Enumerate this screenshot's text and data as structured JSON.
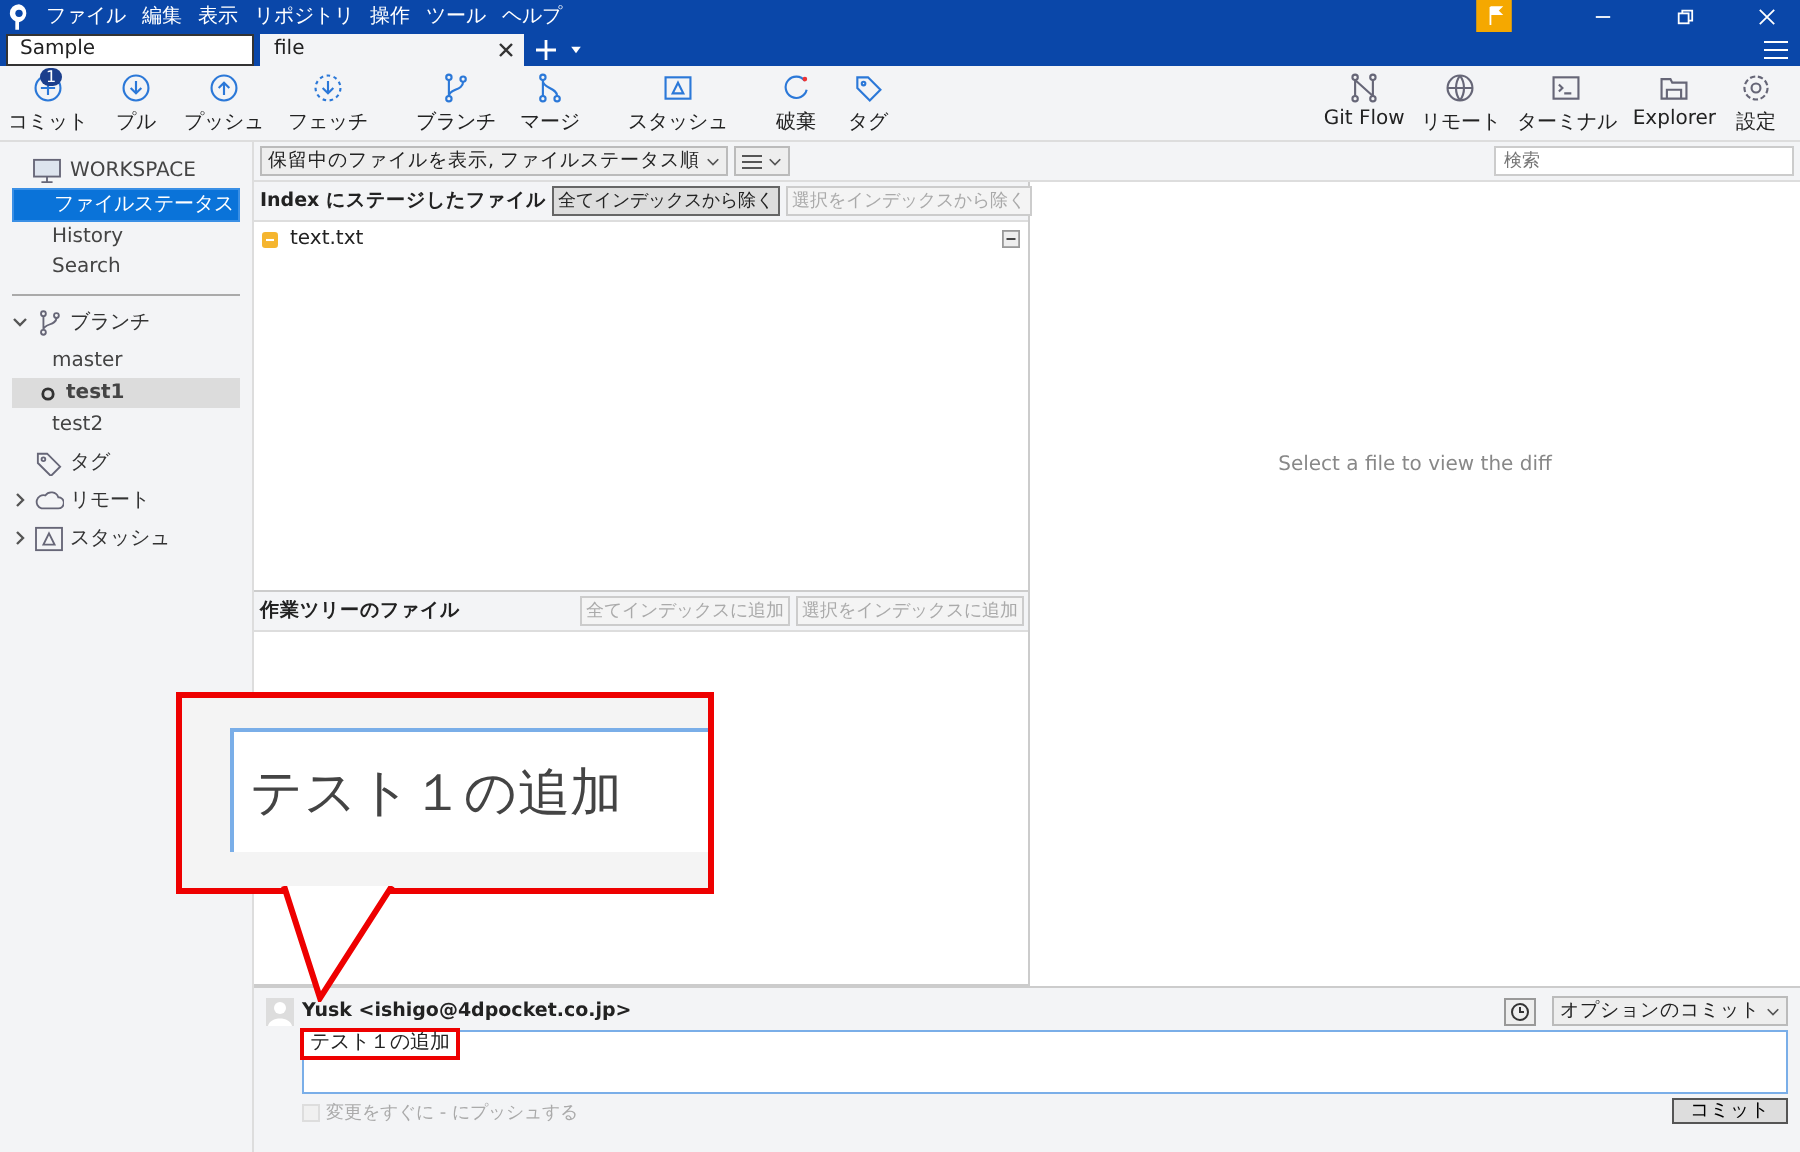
{
  "menu": [
    "ファイル",
    "編集",
    "表示",
    "リポジトリ",
    "操作",
    "ツール",
    "ヘルプ"
  ],
  "tabs": [
    {
      "label": "Sample",
      "selected": false
    },
    {
      "label": "file",
      "selected": true
    }
  ],
  "toolbar_left": [
    {
      "label": "コミット",
      "badge": "1"
    },
    {
      "label": "プル"
    },
    {
      "label": "プッシュ"
    },
    {
      "label": "フェッチ"
    },
    {
      "label": "ブランチ"
    },
    {
      "label": "マージ"
    },
    {
      "label": "スタッシュ"
    },
    {
      "label": "破棄"
    },
    {
      "label": "タグ"
    }
  ],
  "toolbar_right": [
    {
      "label": "Git Flow"
    },
    {
      "label": "リモート"
    },
    {
      "label": "ターミナル"
    },
    {
      "label": "Explorer"
    },
    {
      "label": "設定"
    }
  ],
  "sidebar": {
    "workspace": "WORKSPACE",
    "items": [
      {
        "label": "ファイルステータス",
        "selected": true
      },
      {
        "label": "History",
        "selected": false
      },
      {
        "label": "Search",
        "selected": false
      }
    ],
    "sections": [
      {
        "label": "ブランチ",
        "kind": "tree",
        "expanded": true,
        "children": [
          {
            "label": "master",
            "selected": false
          },
          {
            "label": "test1",
            "selected": true
          },
          {
            "label": "test2",
            "selected": false
          }
        ]
      },
      {
        "label": "タグ",
        "kind": "leaf"
      },
      {
        "label": "リモート",
        "kind": "tree",
        "expanded": false
      },
      {
        "label": "スタッシュ",
        "kind": "tree",
        "expanded": false
      }
    ]
  },
  "filter": {
    "value": "保留中のファイルを表示, ファイルステータス順"
  },
  "search": {
    "placeholder": "検索"
  },
  "staged": {
    "title": "Index にステージしたファイル",
    "buttons": [
      {
        "label": "全てインデックスから除く",
        "disabled": false
      },
      {
        "label": "選択をインデックスから除く",
        "disabled": true
      }
    ],
    "files": [
      {
        "name": "text.txt"
      }
    ]
  },
  "unstaged": {
    "title": "作業ツリーのファイル",
    "buttons": [
      {
        "label": "全てインデックスに追加",
        "disabled": true
      },
      {
        "label": "選択をインデックスに追加",
        "disabled": true
      }
    ]
  },
  "diff": {
    "message": "Select a file to view the diff"
  },
  "commit": {
    "author": "Yusk <ishigo@4dpocket.co.jp>",
    "message": "テスト１の追加",
    "options": "オプションのコミット",
    "push": {
      "label": "変更をすぐに - にプッシュする",
      "checked": false,
      "disabled": true
    },
    "button": "コミット"
  },
  "callout": {
    "text": "テスト１の追加"
  }
}
